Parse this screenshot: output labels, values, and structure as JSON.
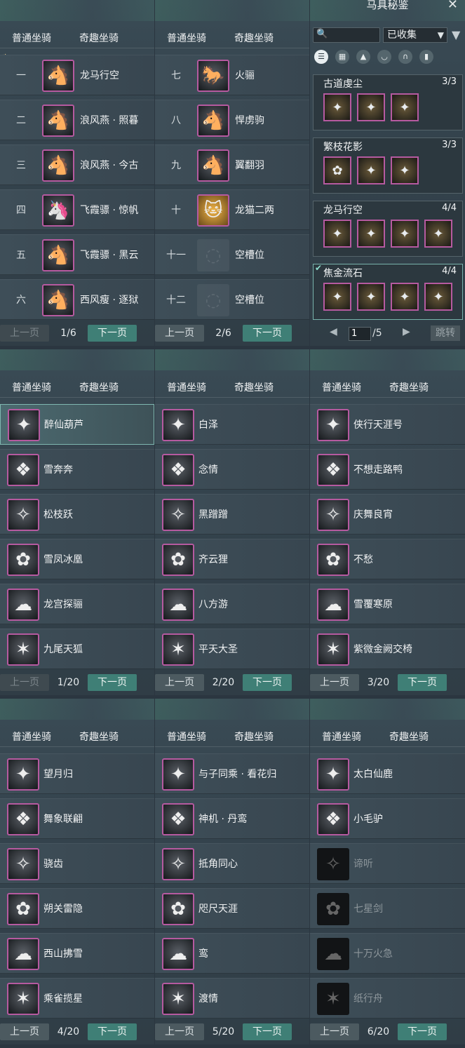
{
  "tabs": {
    "normal": "普通坐骑",
    "fun": "奇趣坐骑"
  },
  "buttons": {
    "prev": "上一页",
    "next": "下一页"
  },
  "normal_panel_1": {
    "rows": [
      {
        "num": "一",
        "name": "龙马行空",
        "icon": "white-horse-icon"
      },
      {
        "num": "二",
        "name": "浪风燕 · 照暮",
        "icon": "cream-horse-icon"
      },
      {
        "num": "三",
        "name": "浪风燕 · 今古",
        "icon": "pale-horse-icon"
      },
      {
        "num": "四",
        "name": "飞霞骠 · 惊帆",
        "icon": "purple-horse-icon"
      },
      {
        "num": "五",
        "name": "飞霞骠 · 黑云",
        "icon": "black-horse-icon"
      },
      {
        "num": "六",
        "name": "西风瘦 · 逐狱",
        "icon": "dark-horse-icon"
      }
    ],
    "page": "1/6"
  },
  "normal_panel_2": {
    "rows": [
      {
        "num": "七",
        "name": "火骊",
        "icon": "fire-horse-icon"
      },
      {
        "num": "八",
        "name": "悍虏驹",
        "icon": "grey-horse-icon"
      },
      {
        "num": "九",
        "name": "翼翻羽",
        "icon": "winged-horse-icon"
      },
      {
        "num": "十",
        "name": "龙猫二两",
        "icon": "cat-icon"
      },
      {
        "num": "十一",
        "name": "空槽位",
        "icon": "empty-slot-icon"
      },
      {
        "num": "十二",
        "name": "空槽位",
        "icon": "empty-slot-icon"
      }
    ],
    "page": "2/6"
  },
  "collection": {
    "title": "马具秘鉴",
    "search_placeholder": "",
    "filter_value": "已收集",
    "sets": [
      {
        "name": "古道虔尘",
        "count": "3/3",
        "items": 3
      },
      {
        "name": "繁枝花影",
        "count": "3/3",
        "items": 3
      },
      {
        "name": "龙马行空",
        "count": "4/4",
        "items": 4
      },
      {
        "name": "焦金流石",
        "count": "4/4",
        "items": 4
      }
    ],
    "page_input": "1",
    "page_total": "/5",
    "jump": "跳转"
  },
  "fun_panels": [
    {
      "page": "1/20",
      "rows": [
        "醉仙葫芦",
        "雪奔奔",
        "松枝跃",
        "雪凤冰凰",
        "龙宫探骊",
        "九尾天狐"
      ]
    },
    {
      "page": "2/20",
      "rows": [
        "白泽",
        "念情",
        "黑蹭蹭",
        "齐云狸",
        "八方游",
        "平天大圣"
      ]
    },
    {
      "page": "3/20",
      "rows": [
        "侠行天涯号",
        "不想走路鸭",
        "庆舞良宵",
        "不愁",
        "雪覆寒原",
        "紫微金阙交椅"
      ]
    },
    {
      "page": "4/20",
      "rows": [
        "望月归",
        "舞象联翩",
        "骁齿",
        "朔关雷隐",
        "西山拂雪",
        "乘雀揽星"
      ]
    },
    {
      "page": "5/20",
      "rows": [
        "与子同乘 · 看花归",
        "神机 · 丹鸾",
        "抵角同心",
        "咫尺天涯",
        "鸾",
        "渡情"
      ]
    },
    {
      "page": "6/20",
      "rows": [
        "太白仙鹿",
        "小毛驴",
        "谛听",
        "七星剑",
        "十万火急",
        "纸行舟"
      ]
    }
  ]
}
